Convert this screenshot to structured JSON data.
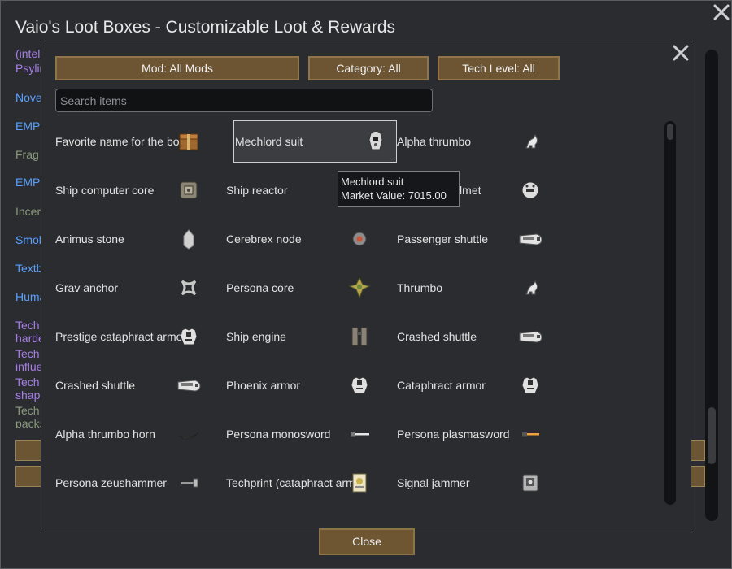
{
  "background_window": {
    "title": "Vaio's Loot Boxes - Customizable Loot & Rewards",
    "close_button": "Close",
    "left_items": [
      {
        "text": "(intel",
        "color": "#a77ee8"
      },
      {
        "text": "Psylin",
        "color": "#a77ee8"
      },
      {
        "text": "Nove",
        "color": "#5aa0ff"
      },
      {
        "text": "EMP",
        "color": "#5aa0ff"
      },
      {
        "text": "Frag",
        "color": "#8a9a7a"
      },
      {
        "text": "EMP",
        "color": "#5aa0ff"
      },
      {
        "text": "Incer",
        "color": "#8a9a7a"
      },
      {
        "text": "Smok",
        "color": "#5aa0ff"
      },
      {
        "text": "Textb",
        "color": "#5aa0ff"
      },
      {
        "text": "Huma",
        "color": "#5aa0ff"
      },
      {
        "text": "Tech",
        "color": "#a77ee8"
      },
      {
        "text": "harde",
        "color": "#a77ee8"
      },
      {
        "text": "Tech",
        "color": "#a77ee8"
      },
      {
        "text": "influe",
        "color": "#a77ee8"
      },
      {
        "text": "Tech",
        "color": "#a77ee8"
      },
      {
        "text": "shap",
        "color": "#a77ee8"
      },
      {
        "text": "Tech",
        "color": "#8a9a7a"
      },
      {
        "text": "packs",
        "color": "#8a9a7a"
      }
    ]
  },
  "dialog": {
    "filters": {
      "mod": "Mod: All Mods",
      "category": "Category: All",
      "tech_level": "Tech Level: All"
    },
    "search": {
      "placeholder": "Search items",
      "value": ""
    },
    "items": [
      {
        "label": "Favorite name for the box",
        "icon": "loot-box-icon"
      },
      {
        "label": "Mechlord suit",
        "icon": "mechlord-suit-icon"
      },
      {
        "label": "Alpha thrumbo",
        "icon": "thrumbo-icon"
      },
      {
        "label": "Ship computer core",
        "icon": "computer-core-icon"
      },
      {
        "label": "Ship reactor",
        "icon": "reactor-icon"
      },
      {
        "label": "Mechlord helmet",
        "icon": "helmet-icon"
      },
      {
        "label": "Animus stone",
        "icon": "stone-icon"
      },
      {
        "label": "Cerebrex node",
        "icon": "node-icon"
      },
      {
        "label": "Passenger shuttle",
        "icon": "shuttle-icon"
      },
      {
        "label": "Grav anchor",
        "icon": "grav-anchor-icon"
      },
      {
        "label": "Persona core",
        "icon": "persona-core-icon"
      },
      {
        "label": "Thrumbo",
        "icon": "thrumbo-icon"
      },
      {
        "label": "Prestige cataphract armor",
        "icon": "armor-icon"
      },
      {
        "label": "Ship engine",
        "icon": "engine-icon"
      },
      {
        "label": "Crashed shuttle",
        "icon": "shuttle-icon"
      },
      {
        "label": "Crashed shuttle",
        "icon": "shuttle-icon"
      },
      {
        "label": "Phoenix armor",
        "icon": "armor-icon"
      },
      {
        "label": "Cataphract armor",
        "icon": "armor-icon"
      },
      {
        "label": "Alpha thrumbo horn",
        "icon": "horn-icon"
      },
      {
        "label": "Persona monosword",
        "icon": "sword-icon"
      },
      {
        "label": "Persona plasmasword",
        "icon": "plasmasword-icon"
      },
      {
        "label": "Persona zeushammer",
        "icon": "hammer-icon"
      },
      {
        "label": "Techprint (cataphract armor)",
        "icon": "techprint-icon"
      },
      {
        "label": "Signal jammer",
        "icon": "jammer-icon"
      }
    ],
    "tooltip": {
      "line1": "Mechlord suit",
      "line2": "Market Value: 7015.00"
    },
    "selected_index": 1
  },
  "colors": {
    "button": "#6d5432",
    "button_border": "#8f7549",
    "panel": "#2a2c2f"
  }
}
